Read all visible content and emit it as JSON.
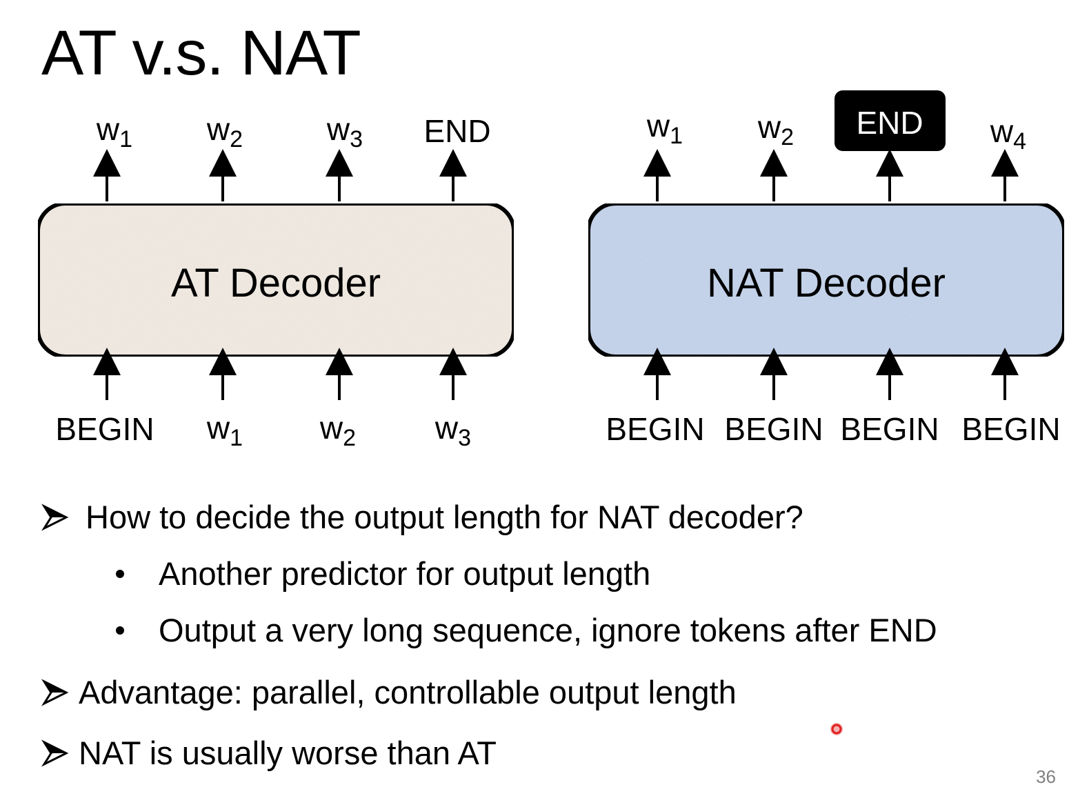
{
  "title": "AT v.s. NAT",
  "at": {
    "decoder_label": "AT Decoder",
    "outputs": [
      {
        "base": "w",
        "sub": "1"
      },
      {
        "base": "w",
        "sub": "2"
      },
      {
        "base": "w",
        "sub": "3"
      },
      {
        "base": "END",
        "sub": ""
      }
    ],
    "inputs": [
      {
        "base": "BEGIN",
        "sub": ""
      },
      {
        "base": "w",
        "sub": "1"
      },
      {
        "base": "w",
        "sub": "2"
      },
      {
        "base": "w",
        "sub": "3"
      }
    ],
    "box_color": "#f5eee6"
  },
  "nat": {
    "decoder_label": "NAT Decoder",
    "outputs": [
      {
        "base": "w",
        "sub": "1"
      },
      {
        "base": "w",
        "sub": "2"
      },
      {
        "base": "END",
        "sub": ""
      },
      {
        "base": "w",
        "sub": "4"
      }
    ],
    "inputs": [
      {
        "base": "BEGIN",
        "sub": ""
      },
      {
        "base": "BEGIN",
        "sub": ""
      },
      {
        "base": "BEGIN",
        "sub": ""
      },
      {
        "base": "BEGIN",
        "sub": ""
      }
    ],
    "box_color": "#c9d8ef"
  },
  "bullets": {
    "q1": "How to decide the output length for NAT decoder?",
    "q1_sub1": "Another predictor for output length",
    "q1_sub2": "Output a very long sequence, ignore tokens after END",
    "adv": "Advantage: parallel, controllable output length",
    "worse": "NAT is usually worse than AT"
  },
  "page_number": "36",
  "colors": {
    "end_badge": "#000000",
    "cursor": "#e02020"
  }
}
